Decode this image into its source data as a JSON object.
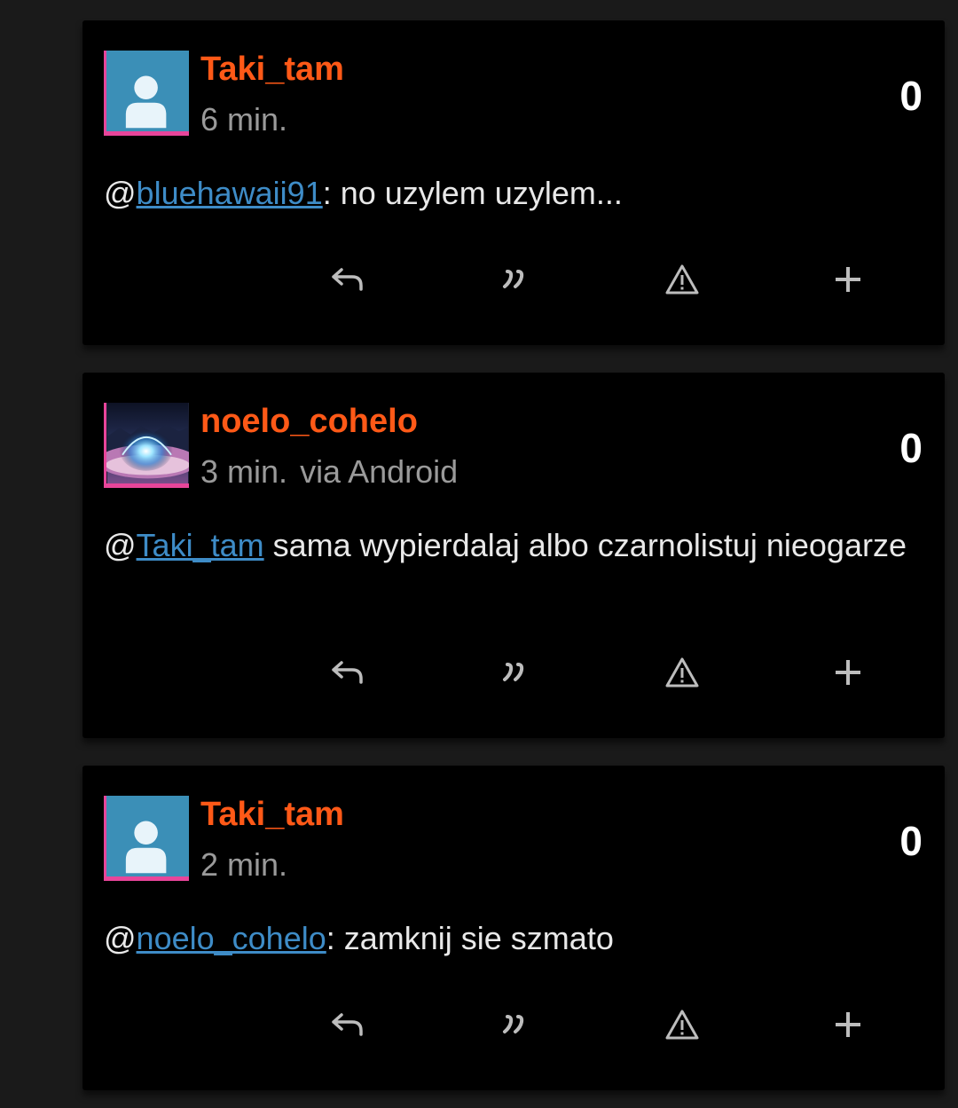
{
  "comments": [
    {
      "author": "Taki_tam",
      "time": "6 min.",
      "via": "",
      "votes": "0",
      "avatar": "default-user-avatar",
      "body": {
        "prefix": "@",
        "mention": "bluehawaii91",
        "text": ": no uzylem uzylem..."
      }
    },
    {
      "author": "noelo_cohelo",
      "time": "3 min.",
      "via": "via Android",
      "votes": "0",
      "avatar": "photo-avatar-dome",
      "body": {
        "prefix": "@",
        "mention": "Taki_tam",
        "text": " sama wypierdalaj albo czarnolistuj nieogarze"
      }
    },
    {
      "author": "Taki_tam",
      "time": "2 min.",
      "via": "",
      "votes": "0",
      "avatar": "default-user-avatar",
      "body": {
        "prefix": "@",
        "mention": "noelo_cohelo",
        "text": ": zamknij sie szmato"
      }
    }
  ],
  "actions": [
    "reply-icon",
    "quote-icon",
    "report-icon",
    "plus-icon"
  ],
  "colors": {
    "author": "#ff5917",
    "mention": "#3e8cc7",
    "avatar_border": "#e8459a",
    "background": "#1a1a1a",
    "card": "#000000"
  }
}
